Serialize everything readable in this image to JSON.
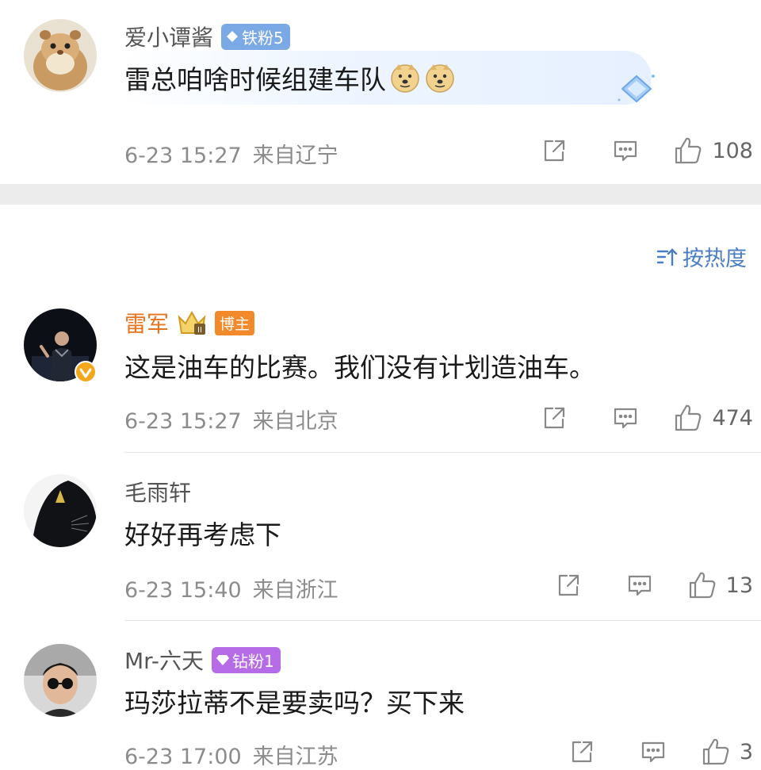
{
  "sort": {
    "label": "按热度",
    "icon": "sort-icon"
  },
  "comments": [
    {
      "username": "爱小谭酱",
      "badge": "铁粉5",
      "text": "雷总咱啥时候组建车队",
      "emoji": "doge-emoji",
      "date": "6-23 15:27",
      "location": "来自辽宁",
      "likes": "108"
    },
    {
      "username": "雷军",
      "badge": "博主",
      "text": "这是油车的比赛。我们没有计划造油车。",
      "date": "6-23 15:27",
      "location": "来自北京",
      "likes": "474"
    },
    {
      "username": "毛雨轩",
      "text": "好好再考虑下",
      "date": "6-23 15:40",
      "location": "来自浙江",
      "likes": "13"
    },
    {
      "username": "Mr-六天",
      "badge": "钻粉1",
      "text": "玛莎拉蒂不是要卖吗？买下来",
      "date": "6-23 17:00",
      "location": "来自江苏",
      "likes": "3"
    }
  ],
  "colors": {
    "author_name": "#e8731e",
    "link_blue": "#4a7ec2",
    "meta_gray": "#8c8c8c"
  }
}
